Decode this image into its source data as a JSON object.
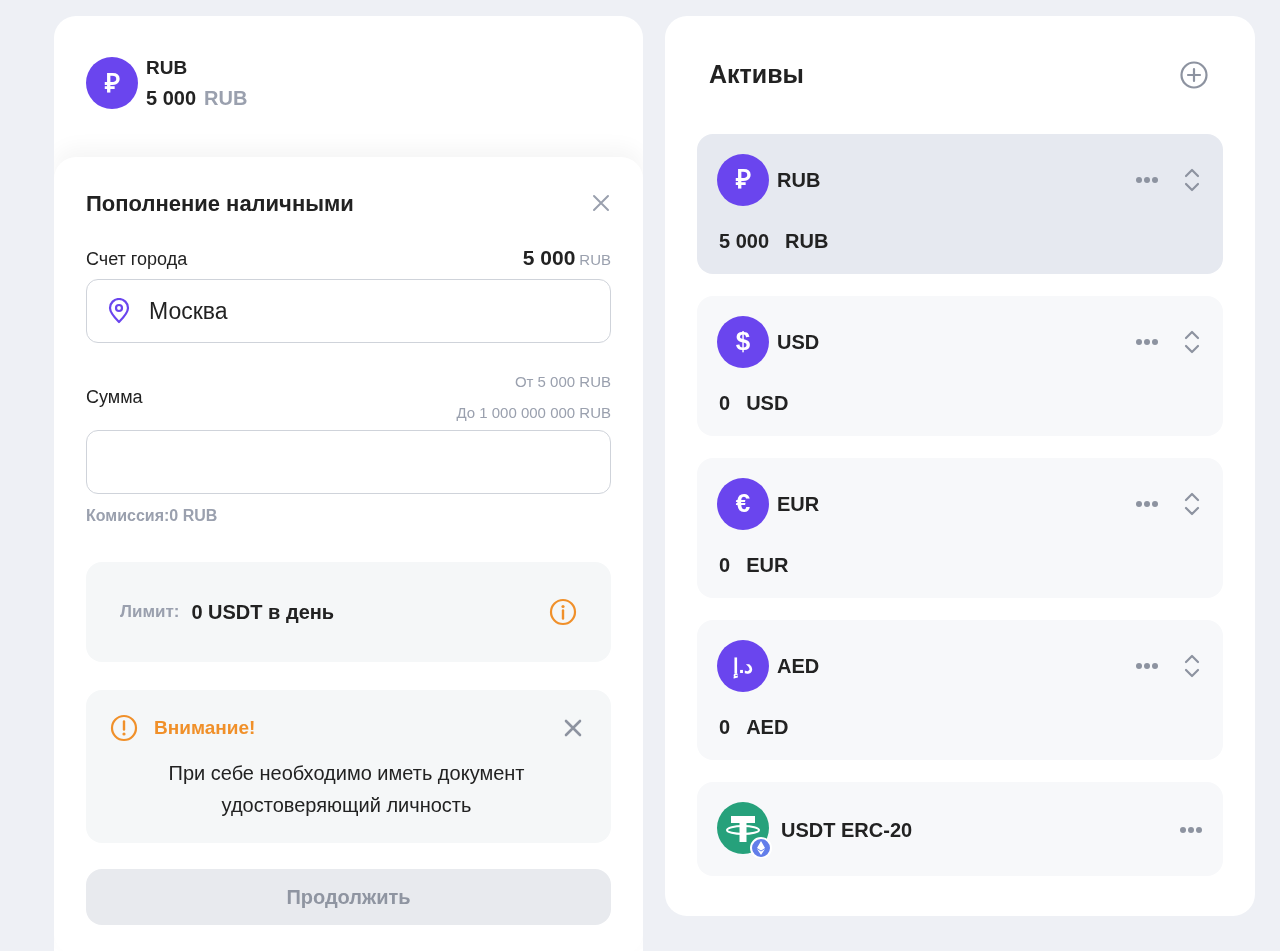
{
  "account": {
    "symbol": "₽",
    "name": "RUB",
    "amount": "5 000",
    "currency": "RUB"
  },
  "deposit_form": {
    "title": "Пополнение наличными",
    "city": {
      "label": "Счет города",
      "balance": "5 000",
      "balance_currency": "RUB",
      "value": "Москва"
    },
    "amount": {
      "label": "Сумма",
      "min_hint": "От 5 000 RUB",
      "max_hint": "До 1 000 000 000 RUB"
    },
    "commission": "Комиссия:0 RUB",
    "limit": {
      "label": "Лимит:",
      "value": "0 USDT в день"
    },
    "warning": {
      "title": "Внимание!",
      "text": "При себе необходимо иметь документ удостоверяющий личность"
    },
    "submit": {
      "label": "Продолжить",
      "disabled": true
    }
  },
  "assets": {
    "title": "Активы",
    "items": [
      {
        "kind": "fiat",
        "symbol": "₽",
        "name": "RUB",
        "amount": "5 000",
        "currency": "RUB",
        "selected": true,
        "sortable": true
      },
      {
        "kind": "fiat",
        "symbol": "$",
        "name": "USD",
        "amount": "0",
        "currency": "USD",
        "selected": false,
        "sortable": true
      },
      {
        "kind": "fiat",
        "symbol": "€",
        "name": "EUR",
        "amount": "0",
        "currency": "EUR",
        "selected": false,
        "sortable": true
      },
      {
        "kind": "fiat",
        "symbol": "د.إ",
        "name": "AED",
        "amount": "0",
        "currency": "AED",
        "selected": false,
        "sortable": true
      },
      {
        "kind": "crypto",
        "name": "USDT ERC-20",
        "selected": false,
        "sortable": false
      }
    ]
  }
}
